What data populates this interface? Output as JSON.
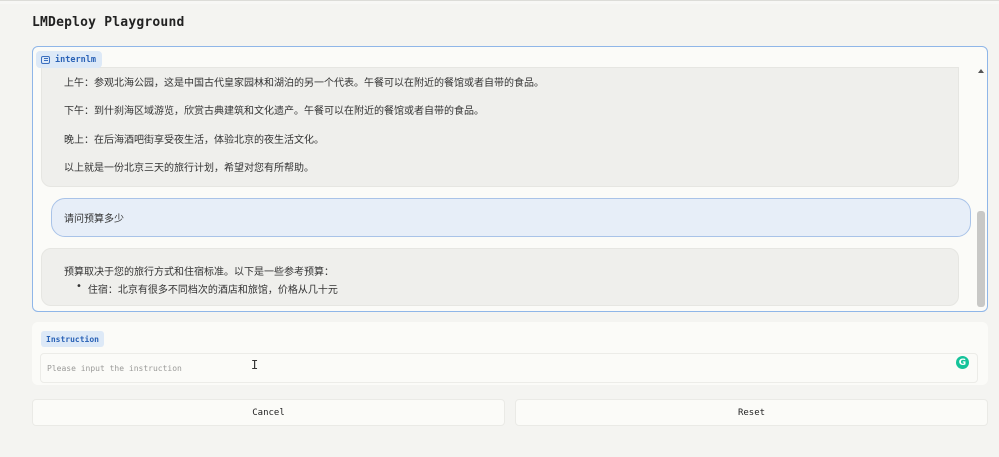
{
  "page": {
    "title": "LMDeploy Playground"
  },
  "chatbot": {
    "label": "internlm",
    "messages": [
      {
        "role": "assistant",
        "lines": [
          "上午：参观北海公园，这是中国古代皇家园林和湖泊的另一个代表。午餐可以在附近的餐馆或者自带的食品。",
          "下午：到什刹海区域游览，欣赏古典建筑和文化遗产。午餐可以在附近的餐馆或者自带的食品。",
          "晚上：在后海酒吧街享受夜生活，体验北京的夜生活文化。",
          "以上就是一份北京三天的旅行计划，希望对您有所帮助。"
        ]
      },
      {
        "role": "user",
        "text": "请问预算多少"
      },
      {
        "role": "assistant",
        "intro": "预算取决于您的旅行方式和住宿标准。以下是一些参考预算：",
        "bullets": [
          "住宿：北京有很多不同档次的酒店和旅馆，价格从几十元"
        ]
      }
    ]
  },
  "instruction": {
    "label": "Instruction",
    "placeholder": "Please input the instruction",
    "value": ""
  },
  "buttons": {
    "cancel": "Cancel",
    "reset": "Reset"
  },
  "icons": {
    "chat_label_icon": "chatbot-icon",
    "text_cursor": "text-cursor-icon",
    "grammarly": "grammarly-icon"
  },
  "colors": {
    "accent": "#2a62b6",
    "accent_bg": "#dde9f7",
    "panel_border": "#8fb6e8",
    "user_bubble": "#e7eef8",
    "bot_bubble": "#efefec",
    "grammarly": "#15c39a"
  }
}
